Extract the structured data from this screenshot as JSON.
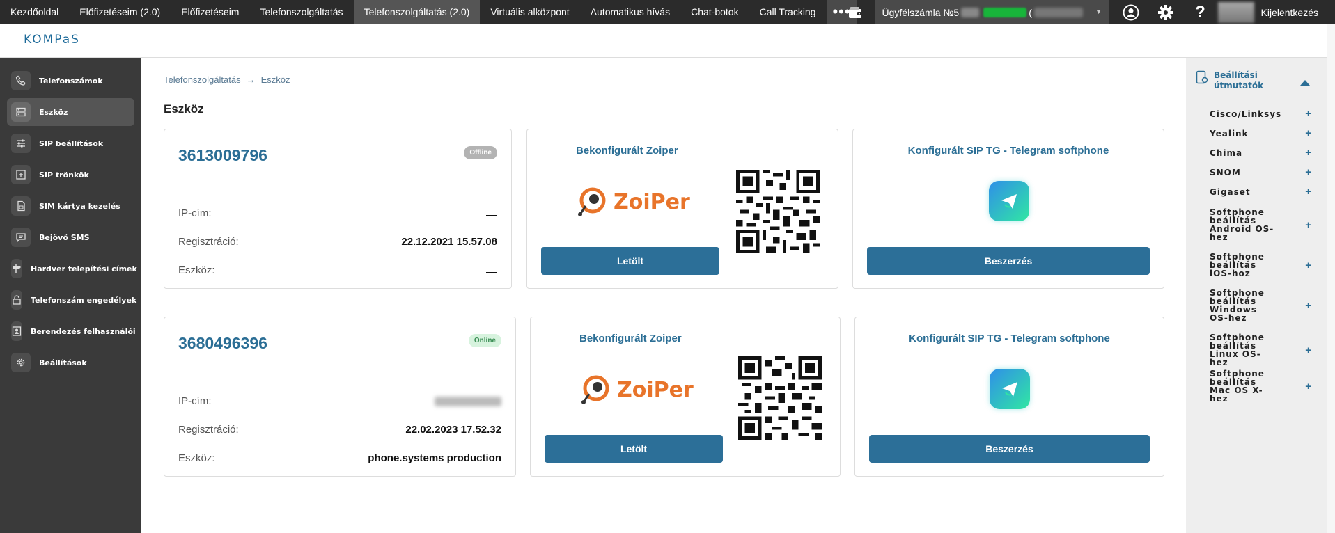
{
  "topnav": {
    "tabs": [
      "Kezdőoldal",
      "Előfizetéseim (2.0)",
      "Előfizetéseim",
      "Telefonszolgáltatás",
      "Telefonszolgáltatás (2.0)",
      "Virtuális alközpont",
      "Automatikus hívás",
      "Chat-botok",
      "Call Tracking"
    ],
    "active_tab": "Telefonszolgáltatás (2.0)",
    "more_label": "•••",
    "account_label": "Ügyfélszámla №5",
    "account_paren": "(",
    "logout_label": "Kijelentkezés"
  },
  "logo": {
    "text": "KOMPaS"
  },
  "sidebar": {
    "items": [
      {
        "label": "Telefonszámok",
        "icon": "phone-icon"
      },
      {
        "label": "Eszköz",
        "icon": "server-icon",
        "active": true
      },
      {
        "label": "SIP beállítások",
        "icon": "sliders-icon"
      },
      {
        "label": "SIP trönkök",
        "icon": "trunk-icon"
      },
      {
        "label": "SIM kártya kezelés",
        "icon": "sim-card-icon"
      },
      {
        "label": "Bejövő SMS",
        "icon": "sms-icon"
      },
      {
        "label": "Hardver telepítési címek",
        "icon": "signpost-icon"
      },
      {
        "label": "Telefonszám engedélyek",
        "icon": "lock-icon"
      },
      {
        "label": "Berendezés felhasználói",
        "icon": "user-card-icon"
      },
      {
        "label": "Beállítások",
        "icon": "gear-icon"
      }
    ]
  },
  "breadcrumb": {
    "parent": "Telefonszolgáltatás",
    "separator": "→",
    "current": "Eszköz"
  },
  "page_title": "Eszköz",
  "devices": [
    {
      "number": "3613009796",
      "status": "Offline",
      "ip_label": "IP-cím:",
      "ip_value": "—",
      "reg_label": "Regisztráció:",
      "reg_value": "22.12.2021 15.57.08",
      "device_label": "Eszköz:",
      "device_value": "—",
      "zoiper_title": "Bekonfigurált Zoiper",
      "zoiper_logo": "ZoiPer",
      "zoiper_button": "Letölt",
      "tg_title": "Konfigurált SIP TG - Telegram softphone",
      "tg_button": "Beszerzés"
    },
    {
      "number": "3680496396",
      "status": "Online",
      "ip_label": "IP-cím:",
      "ip_value": "",
      "reg_label": "Regisztráció:",
      "reg_value": "22.02.2023 17.52.32",
      "device_label": "Eszköz:",
      "device_value": "phone.systems production",
      "zoiper_title": "Bekonfigurált Zoiper",
      "zoiper_logo": "ZoiPer",
      "zoiper_button": "Letölt",
      "tg_title": "Konfigurált SIP TG - Telegram softphone",
      "tg_button": "Beszerzés"
    }
  ],
  "right_panel": {
    "title": "Beállítási útmutatók",
    "items": [
      "Cisco/Linksys",
      "Yealink",
      "Chima",
      "SNOM",
      "Gigaset",
      "Softphone beállítás Android OS-hez",
      "Softphone beállítás iOS-hoz",
      "Softphone beállítás Windows OS-hez",
      "Softphone beállítás Linux OS-hez",
      "Softphone beállítás Mac OS X-hez"
    ]
  },
  "colors": {
    "accent": "#2c6f98",
    "nav_bg": "#2b2b2b",
    "sidebar_bg": "#3a3a3a",
    "zoiper_orange": "#e8742a"
  }
}
